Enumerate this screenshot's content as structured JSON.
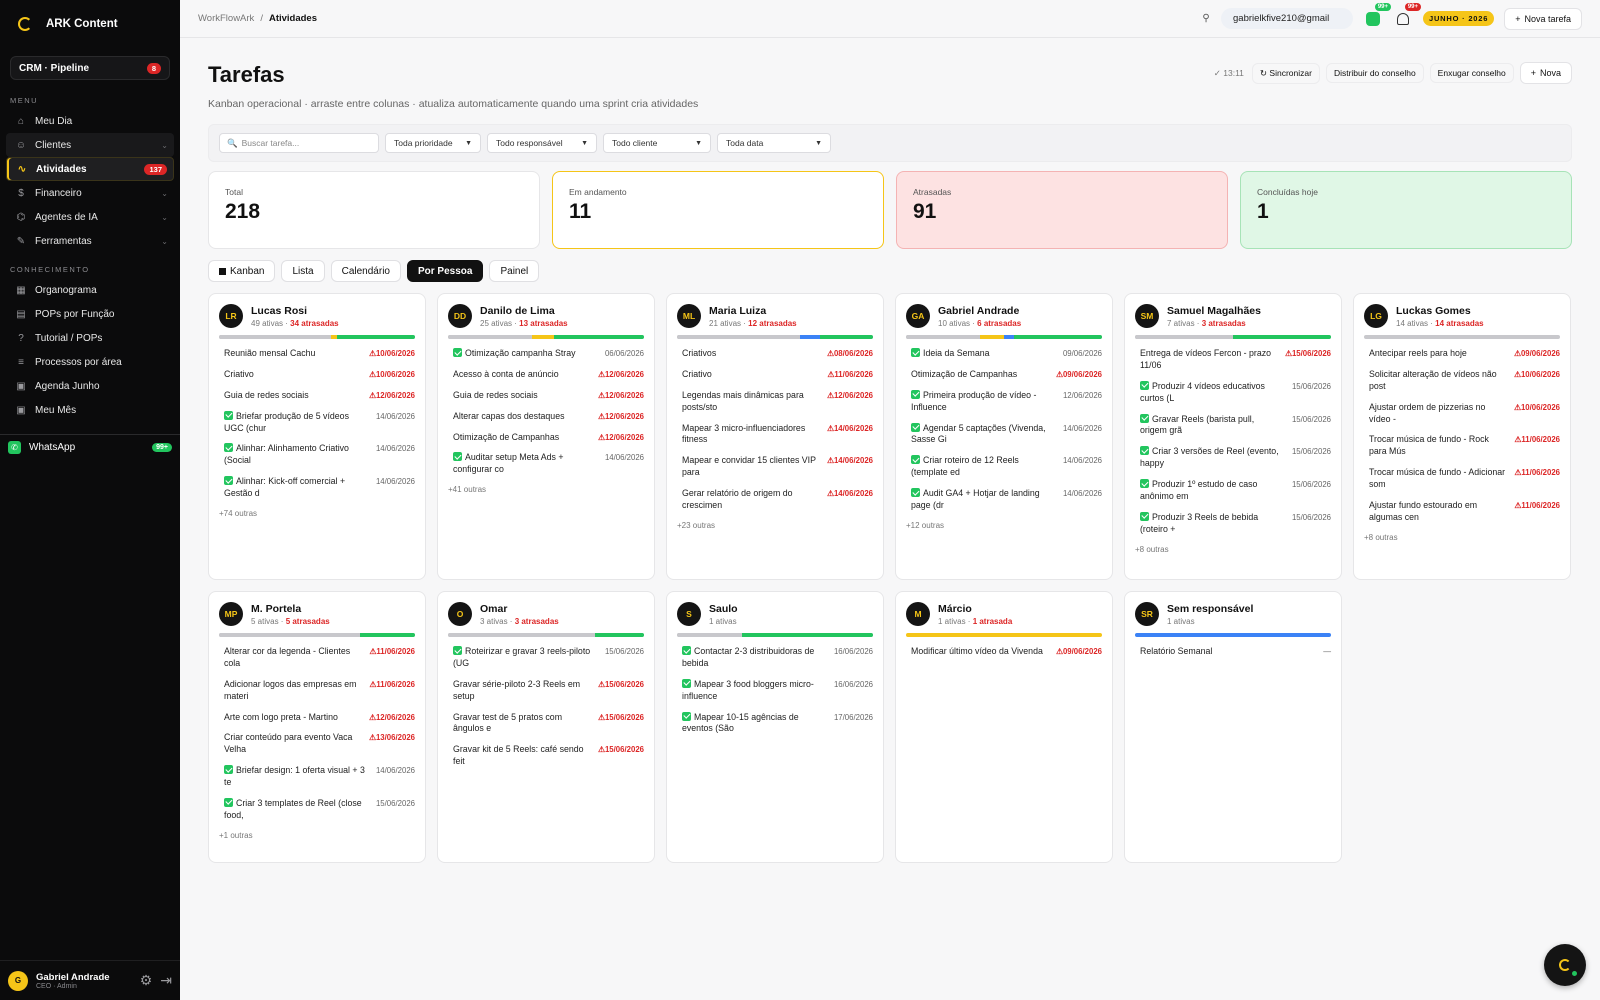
{
  "app": {
    "name": "ARK Content",
    "crm_label": "CRM · Pipeline",
    "crm_badge": "8"
  },
  "sidebar": {
    "menu_label": "MENU",
    "knowledge_label": "CONHECIMENTO",
    "items": [
      {
        "label": "Meu Dia",
        "icon": "home-icon"
      },
      {
        "label": "Clientes",
        "icon": "user-icon"
      },
      {
        "label": "Atividades",
        "icon": "activity-icon",
        "badge": "137"
      },
      {
        "label": "Financeiro",
        "icon": "dollar-icon"
      },
      {
        "label": "Agentes de IA",
        "icon": "bot-icon"
      },
      {
        "label": "Ferramentas",
        "icon": "tool-icon"
      }
    ],
    "knowledge": [
      {
        "label": "Organograma",
        "icon": "org-icon"
      },
      {
        "label": "POPs por Função",
        "icon": "doc-icon"
      },
      {
        "label": "Tutorial / POPs",
        "icon": "help-icon"
      },
      {
        "label": "Processos por área",
        "icon": "list-icon"
      },
      {
        "label": "Agenda Junho",
        "icon": "calendar-icon"
      },
      {
        "label": "Meu Mês",
        "icon": "calendar-icon"
      }
    ],
    "whatsapp": {
      "label": "WhatsApp",
      "badge": "99+"
    },
    "user": {
      "initial": "G",
      "name": "Gabriel Andrade",
      "role": "CEO · Admin"
    }
  },
  "topbar": {
    "crumb_root": "WorkFlowArk",
    "crumb_sep": "/",
    "crumb_current": "Atividades",
    "email": "gabrielkfive210@gmail",
    "wa_count": "99+",
    "bell_count": "99+",
    "month": "JUNHO · 2026",
    "new_task": "Nova tarefa"
  },
  "header": {
    "title": "Tarefas",
    "subtitle": "Kanban operacional · arraste entre colunas · atualiza automaticamente quando uma sprint cria atividades",
    "time": "✓ 13:11",
    "sync": "Sincronizar",
    "distribute": "Distribuir do conselho",
    "clean": "Enxugar conselho",
    "new": "Nova"
  },
  "filters": {
    "search_placeholder": "Buscar tarefa...",
    "priority": "Toda prioridade",
    "responsible": "Todo responsável",
    "client": "Todo cliente",
    "date": "Toda data"
  },
  "kpis": [
    {
      "label": "Total",
      "value": "218"
    },
    {
      "label": "Em andamento",
      "value": "11"
    },
    {
      "label": "Atrasadas",
      "value": "91"
    },
    {
      "label": "Concluídas hoje",
      "value": "1"
    }
  ],
  "tabs": [
    "Kanban",
    "Lista",
    "Calendário",
    "Por Pessoa",
    "Painel"
  ],
  "colors": {
    "accent": "#f5c518",
    "late": "#dc2626",
    "done": "#22c55e",
    "progress": "#3b82f6",
    "neutral": "#c8c8cc"
  },
  "people": [
    {
      "initials": "LR",
      "name": "Lucas Rosi",
      "active": "49 ativas",
      "late": "34 atrasadas",
      "bar": [
        {
          "w": 57,
          "c": "#c8c8cc"
        },
        {
          "w": 3,
          "c": "#f5c518"
        },
        {
          "w": 40,
          "c": "#22c55e"
        }
      ],
      "tasks": [
        {
          "t": "Reunião mensal Cachu",
          "d": "10/06/2026",
          "od": true
        },
        {
          "t": "Criativo",
          "d": "10/06/2026",
          "od": true
        },
        {
          "t": "Guia de redes sociais",
          "d": "12/06/2026",
          "od": true
        },
        {
          "t": "Briefar produção de 5 vídeos UGC (chur",
          "d": "14/06/2026",
          "done": true
        },
        {
          "t": "Alinhar: Alinhamento Criativo (Social",
          "d": "14/06/2026",
          "done": true
        },
        {
          "t": "Alinhar: Kick-off comercial + Gestão d",
          "d": "14/06/2026",
          "done": true
        }
      ],
      "more": "+74 outras"
    },
    {
      "initials": "DD",
      "name": "Danilo de Lima",
      "active": "25 ativas",
      "late": "13 atrasadas",
      "bar": [
        {
          "w": 43,
          "c": "#c8c8cc"
        },
        {
          "w": 11,
          "c": "#f5c518"
        },
        {
          "w": 46,
          "c": "#22c55e"
        }
      ],
      "tasks": [
        {
          "t": "Otimização campanha Stray",
          "d": "06/06/2026",
          "done": true
        },
        {
          "t": "Acesso à conta de anúncio",
          "d": "12/06/2026",
          "od": true
        },
        {
          "t": "Guia de redes sociais",
          "d": "12/06/2026",
          "od": true
        },
        {
          "t": "Alterar capas dos destaques",
          "d": "12/06/2026",
          "od": true
        },
        {
          "t": "Otimização de Campanhas",
          "d": "12/06/2026",
          "od": true
        },
        {
          "t": "Auditar setup Meta Ads + configurar co",
          "d": "14/06/2026",
          "done": true
        }
      ],
      "more": "+41 outras"
    },
    {
      "initials": "ML",
      "name": "Maria Luiza",
      "active": "21 ativas",
      "late": "12 atrasadas",
      "bar": [
        {
          "w": 63,
          "c": "#c8c8cc"
        },
        {
          "w": 10,
          "c": "#3b82f6"
        },
        {
          "w": 27,
          "c": "#22c55e"
        }
      ],
      "tasks": [
        {
          "t": "Criativos",
          "d": "08/06/2026",
          "od": true
        },
        {
          "t": "Criativo",
          "d": "11/06/2026",
          "od": true
        },
        {
          "t": "Legendas mais dinâmicas para posts/sto",
          "d": "12/06/2026",
          "od": true
        },
        {
          "t": "Mapear 3 micro-influenciadores fitness",
          "d": "14/06/2026",
          "od": true
        },
        {
          "t": "Mapear e convidar 15 clientes VIP para",
          "d": "14/06/2026",
          "od": true
        },
        {
          "t": "Gerar relatório de origem do crescimen",
          "d": "14/06/2026",
          "od": true
        }
      ],
      "more": "+23 outras"
    },
    {
      "initials": "GA",
      "name": "Gabriel Andrade",
      "active": "10 ativas",
      "late": "6 atrasadas",
      "bar": [
        {
          "w": 38,
          "c": "#c8c8cc"
        },
        {
          "w": 12,
          "c": "#f5c518"
        },
        {
          "w": 5,
          "c": "#3b82f6"
        },
        {
          "w": 45,
          "c": "#22c55e"
        }
      ],
      "tasks": [
        {
          "t": "Ideia da Semana",
          "d": "09/06/2026",
          "done": true
        },
        {
          "t": "Otimização de Campanhas",
          "d": "09/06/2026",
          "od": true
        },
        {
          "t": "Primeira produção de vídeo - Influence",
          "d": "12/06/2026",
          "done": true
        },
        {
          "t": "Agendar 5 captações (Vivenda, Sasse Gi",
          "d": "14/06/2026",
          "done": true
        },
        {
          "t": "Criar roteiro de 12 Reels (template ed",
          "d": "14/06/2026",
          "done": true
        },
        {
          "t": "Audit GA4 + Hotjar de landing page (dr",
          "d": "14/06/2026",
          "done": true
        }
      ],
      "more": "+12 outras"
    },
    {
      "initials": "SM",
      "name": "Samuel Magalhães",
      "active": "7 ativas",
      "late": "3 atrasadas",
      "bar": [
        {
          "w": 50,
          "c": "#c8c8cc"
        },
        {
          "w": 50,
          "c": "#22c55e"
        }
      ],
      "tasks": [
        {
          "t": "Entrega de vídeos Fercon - prazo 11/06",
          "d": "15/06/2026",
          "od": true
        },
        {
          "t": "Produzir 4 vídeos educativos curtos (L",
          "d": "15/06/2026",
          "done": true
        },
        {
          "t": "Gravar Reels (barista pull, origem grã",
          "d": "15/06/2026",
          "done": true
        },
        {
          "t": "Criar 3 versões de Reel (evento, happy",
          "d": "15/06/2026",
          "done": true
        },
        {
          "t": "Produzir 1º estudo de caso anônimo em",
          "d": "15/06/2026",
          "done": true
        },
        {
          "t": "Produzir 3 Reels de bebida (roteiro +",
          "d": "15/06/2026",
          "done": true
        }
      ],
      "more": "+8 outras"
    },
    {
      "initials": "LG",
      "name": "Luckas Gomes",
      "active": "14 ativas",
      "late": "14 atrasadas",
      "bar": [
        {
          "w": 100,
          "c": "#c8c8cc"
        }
      ],
      "tasks": [
        {
          "t": "Antecipar reels para hoje",
          "d": "09/06/2026",
          "od": true
        },
        {
          "t": "Solicitar alteração de vídeos não post",
          "d": "10/06/2026",
          "od": true
        },
        {
          "t": "Ajustar ordem de pizzerias no vídeo -",
          "d": "10/06/2026",
          "od": true
        },
        {
          "t": "Trocar música de fundo - Rock para Mús",
          "d": "11/06/2026",
          "od": true
        },
        {
          "t": "Trocar música de fundo - Adicionar som",
          "d": "11/06/2026",
          "od": true
        },
        {
          "t": "Ajustar fundo estourado em algumas cen",
          "d": "11/06/2026",
          "od": true
        }
      ],
      "more": "+8 outras"
    },
    {
      "initials": "MP",
      "name": "M. Portela",
      "active": "5 ativas",
      "late": "5 atrasadas",
      "bar": [
        {
          "w": 72,
          "c": "#c8c8cc"
        },
        {
          "w": 28,
          "c": "#22c55e"
        }
      ],
      "tasks": [
        {
          "t": "Alterar cor da legenda - Clientes cola",
          "d": "11/06/2026",
          "od": true
        },
        {
          "t": "Adicionar logos das empresas em materi",
          "d": "11/06/2026",
          "od": true
        },
        {
          "t": "Arte com logo preta - Martino",
          "d": "12/06/2026",
          "od": true
        },
        {
          "t": "Criar conteúdo para evento Vaca Velha",
          "d": "13/06/2026",
          "od": true
        },
        {
          "t": "Briefar design: 1 oferta visual + 3 te",
          "d": "14/06/2026",
          "done": true
        },
        {
          "t": "Criar 3 templates de Reel (close food,",
          "d": "15/06/2026",
          "done": true
        }
      ],
      "more": "+1 outras"
    },
    {
      "initials": "O",
      "name": "Omar",
      "active": "3 ativas",
      "late": "3 atrasadas",
      "bar": [
        {
          "w": 75,
          "c": "#c8c8cc"
        },
        {
          "w": 25,
          "c": "#22c55e"
        }
      ],
      "tasks": [
        {
          "t": "Roteirizar e gravar 3 reels-piloto (UG",
          "d": "15/06/2026",
          "done": true
        },
        {
          "t": "Gravar série-piloto 2-3 Reels em setup",
          "d": "15/06/2026",
          "od": true
        },
        {
          "t": "Gravar test de 5 pratos com ângulos e",
          "d": "15/06/2026",
          "od": true
        },
        {
          "t": "Gravar kit de 5 Reels: café sendo feit",
          "d": "15/06/2026",
          "od": true
        }
      ],
      "more": ""
    },
    {
      "initials": "S",
      "name": "Saulo",
      "active": "1 ativas",
      "late": "",
      "bar": [
        {
          "w": 33,
          "c": "#c8c8cc"
        },
        {
          "w": 67,
          "c": "#22c55e"
        }
      ],
      "tasks": [
        {
          "t": "Contactar 2-3 distribuidoras de bebida",
          "d": "16/06/2026",
          "done": true
        },
        {
          "t": "Mapear 3 food bloggers micro-influence",
          "d": "16/06/2026",
          "done": true
        },
        {
          "t": "Mapear 10-15 agências de eventos (São",
          "d": "17/06/2026",
          "done": true
        }
      ],
      "more": ""
    },
    {
      "initials": "M",
      "name": "Márcio",
      "active": "1 ativas",
      "late": "1 atrasada",
      "bar": [
        {
          "w": 100,
          "c": "#f5c518"
        }
      ],
      "tasks": [
        {
          "t": "Modificar último vídeo da Vivenda",
          "d": "09/06/2026",
          "od": true
        }
      ],
      "more": ""
    },
    {
      "initials": "SR",
      "name": "Sem responsável",
      "active": "1 ativas",
      "late": "",
      "bar": [
        {
          "w": 100,
          "c": "#3b82f6"
        }
      ],
      "tasks": [
        {
          "t": "Relatório Semanal",
          "d": "—"
        }
      ],
      "more": ""
    }
  ]
}
